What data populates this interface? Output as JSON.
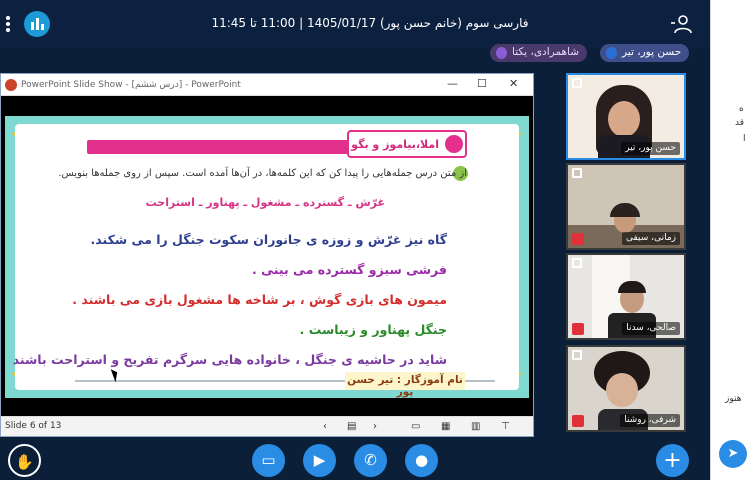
{
  "header": {
    "meeting_title": "فارسی سوم (خانم حسن پور) 1405/01/17 | 11:00 تا 11:45",
    "speakers": [
      "حسن پور، تیر",
      "شاهمرادی، یکتا"
    ]
  },
  "ppt_window": {
    "title": "PowerPoint Slide Show - [درس ششم] - PowerPoint",
    "slide_counter": "Slide 6 of 13"
  },
  "slide": {
    "banner_label": "املا،بیاموز و بگو",
    "instruction": "از متن درس جمله‌هایی را پیدا کن که این کلمه‌ها، در آن‌ها آمده است. سپس از روی جمله‌ها بنویس.",
    "words": "غرّش ـ گسترده ـ مشغول ـ پهناور ـ استراحت",
    "sentences": [
      "گاه نیز غرّش و زوزه ی جانوران سکوت جنگل را می شکند.",
      "فرشی سبزو گسترده می بینی .",
      "میمون های بازی گوش ، بر شاخه ها مشغول بازی می باشند .",
      "جنگل پهناور و زیباست .",
      "شاید در حاشیه ی جنگل ، خانواده هایی سرگرم تفریح و استراحت باشند"
    ],
    "teacher": "نام آموزگار : تیر حسن پور"
  },
  "webcams": [
    {
      "name": "حسن پور، تیر",
      "active": true
    },
    {
      "name": "زمانی، سیفی",
      "active": false
    },
    {
      "name": "صالحی، سدنا",
      "active": false
    },
    {
      "name": "شرفی، روشنا",
      "active": false
    }
  ],
  "right_panel": {
    "fragments": [
      "ه",
      "قد",
      "ا",
      "هنوز"
    ]
  },
  "colors": {
    "accent": "#2b8ce6",
    "topbar": "#0c2140"
  }
}
